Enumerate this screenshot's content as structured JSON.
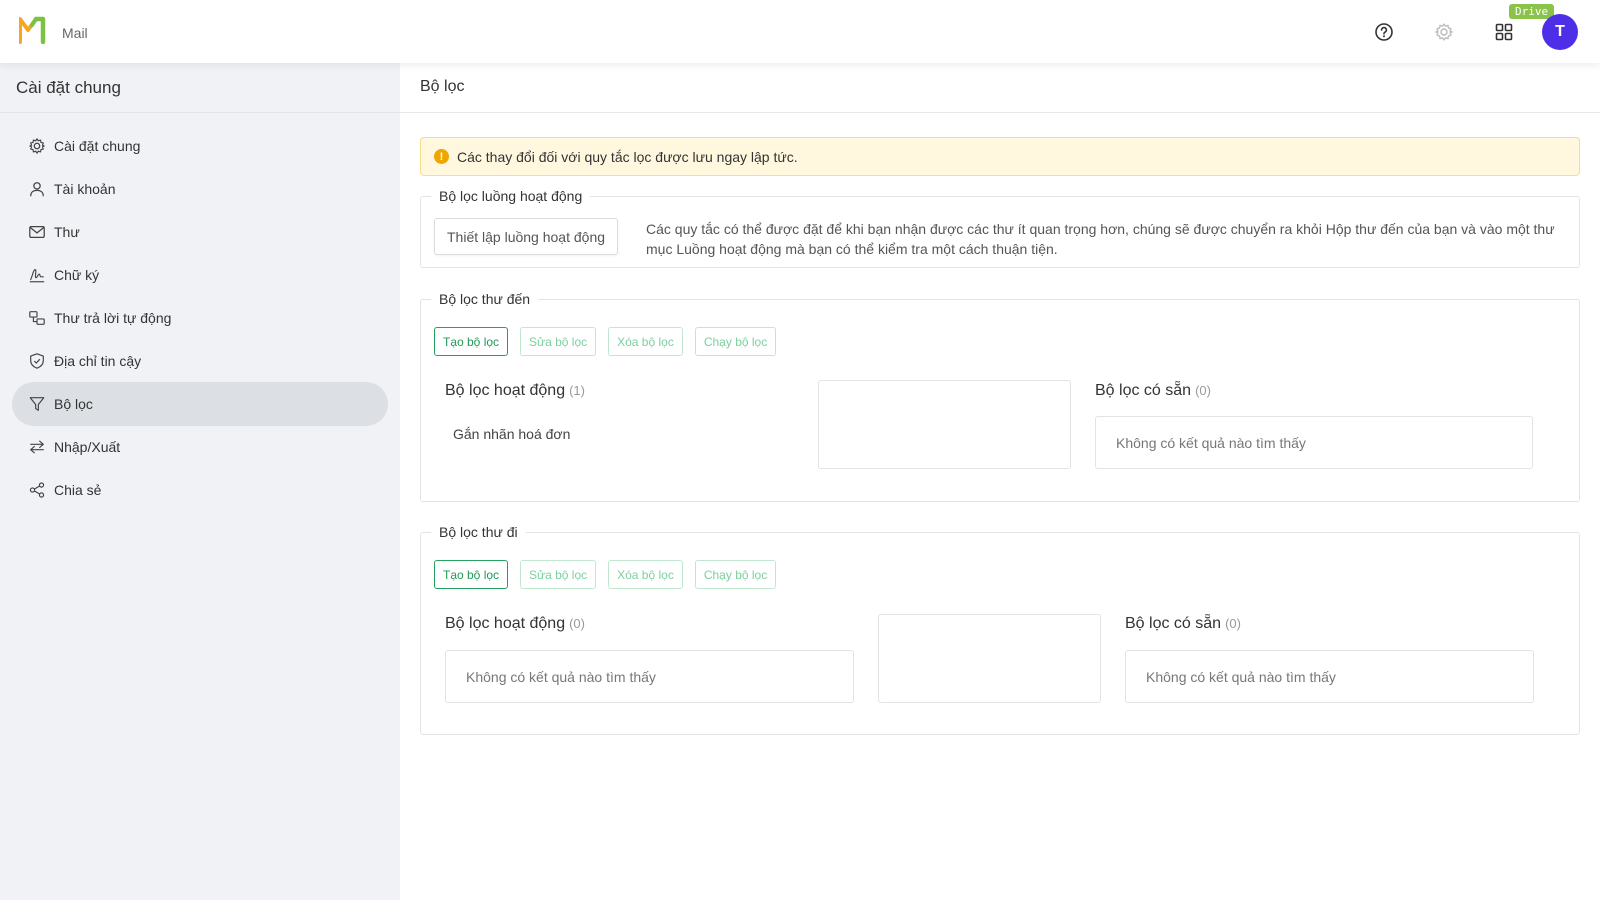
{
  "header": {
    "app_name": "Mail",
    "drive_badge": "Drive",
    "avatar_initial": "T",
    "colors": {
      "logo_orange": "#f5a623",
      "logo_green": "#7cc242",
      "avatar": "#4f2ee8",
      "badge": "#8bc34a"
    }
  },
  "sidebar": {
    "title": "Cài đặt chung",
    "items": [
      {
        "label": "Cài đặt chung",
        "icon": "gear-icon"
      },
      {
        "label": "Tài khoản",
        "icon": "user-icon"
      },
      {
        "label": "Thư",
        "icon": "envelope-icon"
      },
      {
        "label": "Chữ ký",
        "icon": "signature-icon"
      },
      {
        "label": "Thư trả lời tự động",
        "icon": "auto-reply-icon"
      },
      {
        "label": "Địa chỉ tin cậy",
        "icon": "shield-check-icon"
      },
      {
        "label": "Bộ lọc",
        "icon": "filter-icon",
        "active": true
      },
      {
        "label": "Nhập/Xuất",
        "icon": "swap-icon"
      },
      {
        "label": "Chia sẻ",
        "icon": "share-icon"
      }
    ]
  },
  "main": {
    "title": "Bộ lọc",
    "alert": "Các thay đổi đối với quy tắc lọc được lưu ngay lập tức.",
    "activity": {
      "legend": "Bộ lọc luồng hoạt động",
      "button": "Thiết lập luồng hoạt động",
      "description": "Các quy tắc có thể được đặt để khi bạn nhận được các thư ít quan trọng hơn, chúng sẽ được chuyển ra khỏi Hộp thư đến của bạn và vào một thư mục Luồng hoạt động mà bạn có thể kiểm tra một cách thuận tiện."
    },
    "incoming": {
      "legend": "Bộ lọc thư đến",
      "buttons": [
        "Tạo bộ lọc",
        "Sửa bộ lọc",
        "Xóa bộ lọc",
        "Chạy bộ lọc"
      ],
      "active_title": "Bộ lọc hoạt động",
      "active_count": "(1)",
      "active_items": [
        "Gắn nhãn hoá đơn"
      ],
      "available_title": "Bộ lọc có sẵn",
      "available_count": "(0)",
      "available_empty": "Không có kết quả nào tìm thấy"
    },
    "outgoing": {
      "legend": "Bộ lọc thư đi",
      "buttons": [
        "Tạo bộ lọc",
        "Sửa bộ lọc",
        "Xóa bộ lọc",
        "Chạy bộ lọc"
      ],
      "active_title": "Bộ lọc hoạt động",
      "active_count": "(0)",
      "active_empty": "Không có kết quả nào tìm thấy",
      "available_title": "Bộ lọc có sẵn",
      "available_count": "(0)",
      "available_empty": "Không có kết quả nào tìm thấy"
    }
  }
}
